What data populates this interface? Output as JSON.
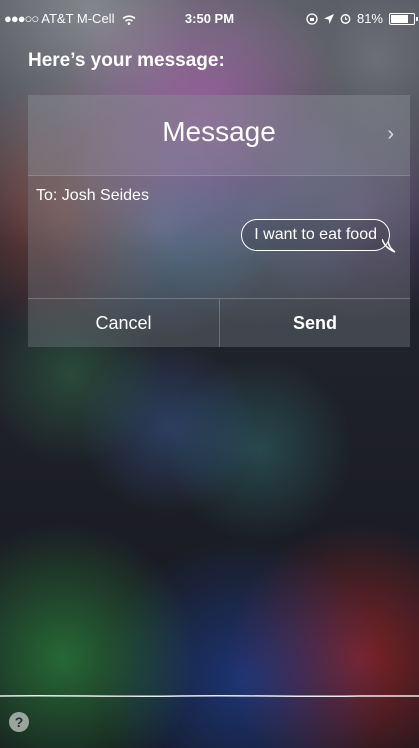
{
  "status_bar": {
    "signal_dots": "●●●○○",
    "carrier": "AT&T M-Cell",
    "time": "3:50 PM",
    "battery": "81%",
    "battery_level": 0.81,
    "icons": [
      "wifi-icon",
      "location-icon",
      "alarm-icon",
      "lock-rotation-icon",
      "battery-icon"
    ]
  },
  "siri": {
    "heading": "Here’s your message:",
    "help_glyph": "?"
  },
  "message_card": {
    "title": "Message",
    "chevron": "›",
    "to": "To: Josh Seides",
    "body": "I want to eat food",
    "cancel_label": "Cancel",
    "send_label": "Send"
  },
  "colors": {
    "card_bg": "rgba(120,125,135,0.38)",
    "text": "#ffffff"
  }
}
